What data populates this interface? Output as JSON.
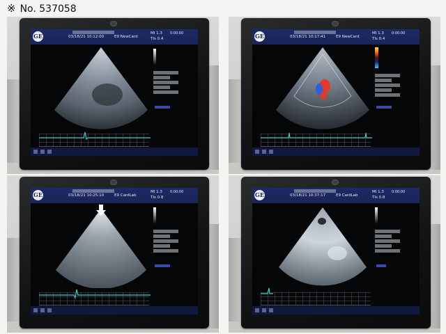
{
  "caption": {
    "mark": "※",
    "text": "No. 537058"
  },
  "panels": [
    {
      "timestamp": "03/18/21  10:12:00",
      "preset": "E9  NewCard",
      "mi": "MI 1.3",
      "tis": "TIs 0.4",
      "time": "0:00:00",
      "mode": "bmode-ecg"
    },
    {
      "timestamp": "03/18/21  10:17:41",
      "preset": "E9  NewCard",
      "mi": "MI 1.3",
      "tis": "TIs 0.4",
      "time": "0:00:00",
      "mode": "color-doppler"
    },
    {
      "timestamp": "03/18/21  10:25:10",
      "preset": "E9  CardLab",
      "mi": "MI 1.3",
      "tis": "TIs 0.8",
      "time": "0:00:00",
      "mode": "bmode-ecg"
    },
    {
      "timestamp": "03/18/21  10:37:17",
      "preset": "E9  CardLab",
      "mi": "MI 1.3",
      "tis": "TIs 0.8",
      "time": "0:00:00",
      "mode": "bmode"
    }
  ],
  "colors": {
    "screen_topbar": "#1d2a68",
    "ecg_trace": "#3fd1c4",
    "doppler_red": "#e23a2a",
    "doppler_blue": "#2a5fe0"
  }
}
